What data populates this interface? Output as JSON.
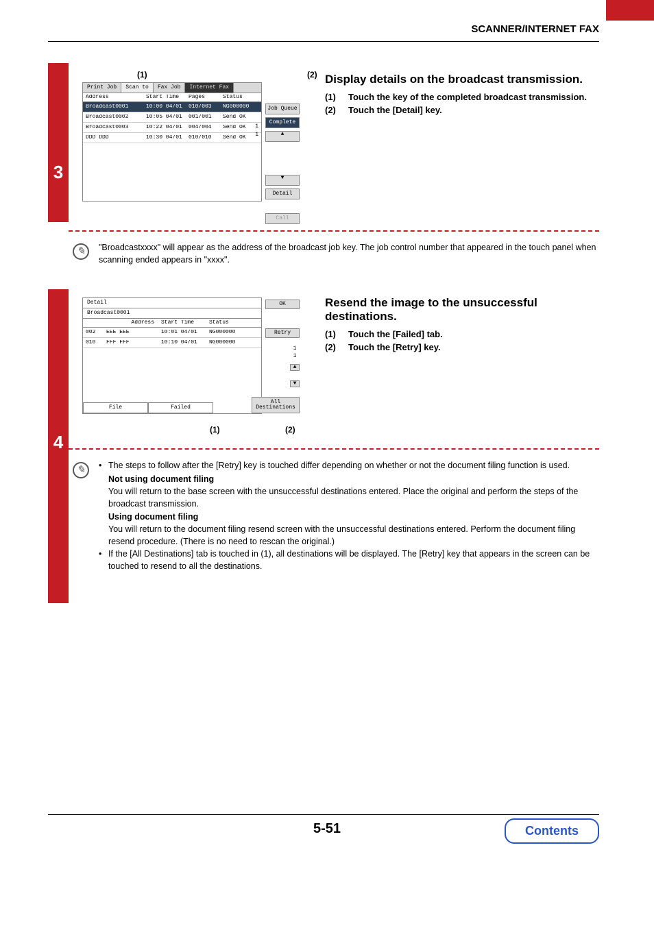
{
  "header": {
    "section": "SCANNER/INTERNET FAX"
  },
  "step3": {
    "num": "3",
    "callouts": {
      "c1": "(1)",
      "c2": "(2)"
    },
    "panel": {
      "tabs": [
        "Print Job",
        "Scan to",
        "Fax Job",
        "Internet Fax"
      ],
      "columns": [
        "Address",
        "Start Time",
        "Pages",
        "Status"
      ],
      "rows": [
        {
          "addr": "Broadcast0001",
          "time": "10:00 04/01",
          "pages": "010/003",
          "status": "NG000000"
        },
        {
          "addr": "Broadcast0002",
          "time": "10:05 04/01",
          "pages": "001/001",
          "status": "Send OK"
        },
        {
          "addr": "Broadcast0003",
          "time": "10:22 04/01",
          "pages": "004/004",
          "status": "Send OK"
        },
        {
          "addr": "DDD DDD",
          "time": "10:30 04/01",
          "pages": "010/010",
          "status": "Send OK"
        }
      ],
      "side": {
        "jobqueue": "Job Queue",
        "complete": "Complete",
        "detail": "Detail",
        "call": "Call",
        "pagecount1": "1",
        "pagecount2": "1"
      }
    },
    "rhs": {
      "title": "Display details on the broadcast transmission.",
      "items": [
        {
          "n": "(1)",
          "t": "Touch the key of the completed broadcast transmission."
        },
        {
          "n": "(2)",
          "t": "Touch the [Detail] key."
        }
      ]
    },
    "note": "\"Broadcastxxxx\" will appear as the address of the broadcast job key. The job control number that appeared in the touch panel when scanning ended appears in \"xxxx\"."
  },
  "step4": {
    "num": "4",
    "callouts": {
      "c1": "(1)",
      "c2": "(2)"
    },
    "panel": {
      "title": "Detail",
      "ok": "OK",
      "bcast": "Broadcast0001",
      "columns": [
        "Address",
        "Start Time",
        "Status"
      ],
      "retry": "Retry",
      "rows": [
        {
          "idx": "002",
          "addr": "EEE EEE",
          "time": "10:01 04/01",
          "status": "NG000000"
        },
        {
          "idx": "010",
          "addr": "FFF FFF",
          "time": "10:10 04/01",
          "status": "NG000000"
        }
      ],
      "bottomtabs": [
        "File",
        "Failed"
      ],
      "alldest": "All Destinations",
      "sidecount": "1\n1"
    },
    "rhs": {
      "title": "Resend the image to the unsuccessful destinations.",
      "items": [
        {
          "n": "(1)",
          "t": "Touch the [Failed] tab."
        },
        {
          "n": "(2)",
          "t": "Touch the [Retry] key."
        }
      ]
    },
    "note": {
      "l1": "The steps to follow after the [Retry] key is touched differ depending on whether or not the document filing function is used.",
      "b1": "Not using document filing",
      "t1": "You will return to the base screen with the unsuccessful destinations entered. Place the original and perform the steps of the broadcast transmission.",
      "b2": "Using document filing",
      "t2": "You will return to the document filing resend screen with the unsuccessful destinations entered. Perform the document filing resend procedure. (There is no need to rescan the original.)",
      "l2": "If the [All Destinations] tab is touched in (1), all destinations will be displayed. The [Retry] key that appears in the screen can be touched to resend to all the destinations."
    }
  },
  "footer": {
    "page": "5-51",
    "contents": "Contents"
  }
}
